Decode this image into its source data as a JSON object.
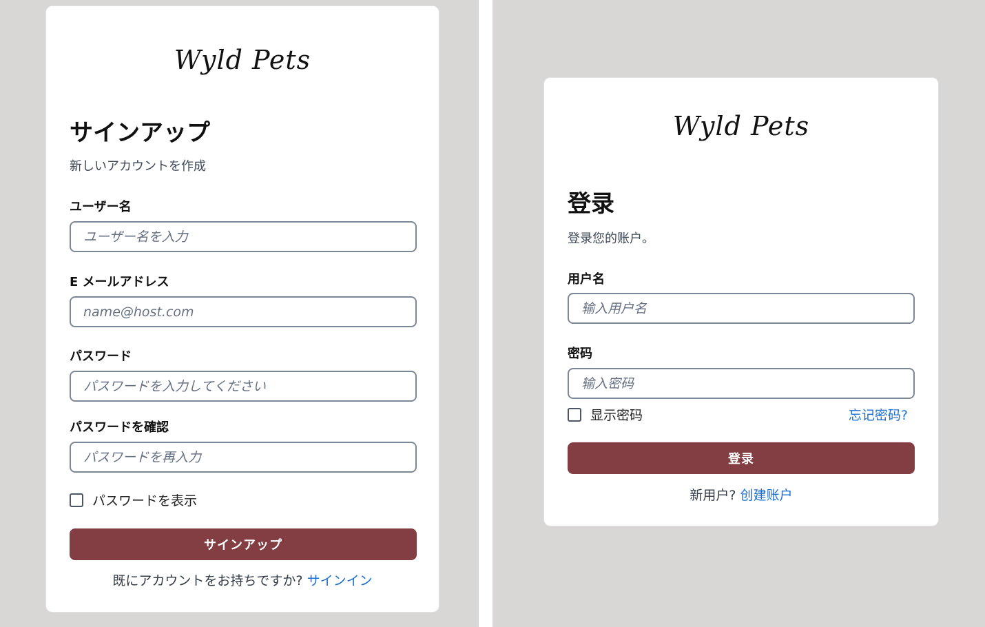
{
  "signup": {
    "logo": "Wyld Pets",
    "heading": "サインアップ",
    "subtitle": "新しいアカウントを作成",
    "username_label": "ユーザー名",
    "username_placeholder": "ユーザー名を入力",
    "email_label": "E メールアドレス",
    "email_placeholder": "name@host.com",
    "password_label": "パスワード",
    "password_placeholder": "パスワードを入力してください",
    "confirm_label": "パスワードを確認",
    "confirm_placeholder": "パスワードを再入力",
    "show_password": "パスワードを表示",
    "submit": "サインアップ",
    "footer_text": "既にアカウントをお持ちですか?",
    "footer_link": "サインイン"
  },
  "login": {
    "logo": "Wyld Pets",
    "heading": "登录",
    "subtitle": "登录您的账户。",
    "username_label": "用户名",
    "username_placeholder": "输入用户名",
    "password_label": "密码",
    "password_placeholder": "输入密码",
    "show_password": "显示密码",
    "forgot": "忘记密码?",
    "submit": "登录",
    "footer_text": "新用户?",
    "footer_link": "创建账户"
  },
  "colors": {
    "accent": "#823e42",
    "link": "#1a6fd1",
    "background": "#d8d7d6"
  }
}
